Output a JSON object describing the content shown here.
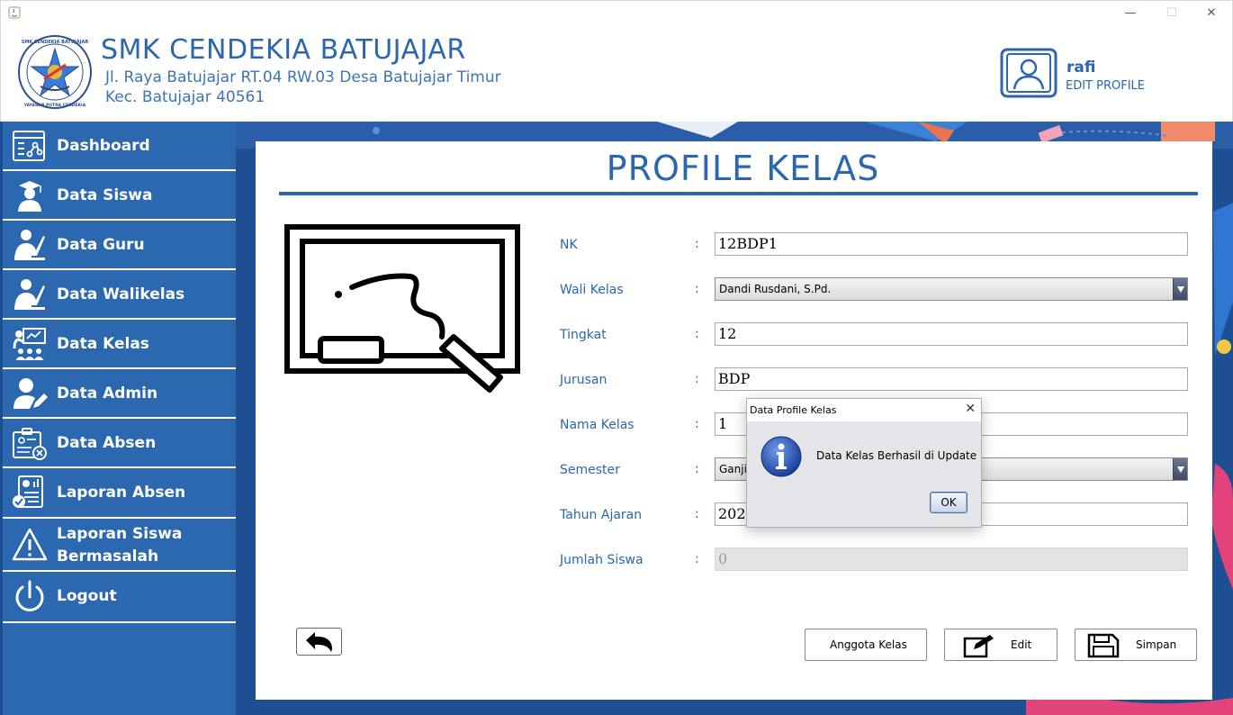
{
  "window": {
    "title": "",
    "min_glyph": "—",
    "max_glyph": "☐",
    "close_glyph": "✕"
  },
  "header": {
    "school_name": "SMK CENDEKIA BATUJAJAR",
    "address_line1": "Jl. Raya Batujajar RT.04 RW.03 Desa Batujajar Timur",
    "address_line2": "Kec. Batujajar 40561",
    "logo_text_top": "SMK CENDEKIA BATUJAJAR",
    "logo_text_bottom": "YAYASAN PUTRA CENDEKIA",
    "user": {
      "name": "rafi",
      "edit_label": "EDIT PROFILE"
    }
  },
  "sidebar": {
    "items": [
      {
        "label": "Dashboard",
        "icon": "dashboard-icon"
      },
      {
        "label": "Data Siswa",
        "icon": "student-icon"
      },
      {
        "label": "Data Guru",
        "icon": "teacher-icon"
      },
      {
        "label": "Data Walikelas",
        "icon": "homeroom-teacher-icon"
      },
      {
        "label": "Data Kelas",
        "icon": "classroom-icon"
      },
      {
        "label": "Data Admin",
        "icon": "admin-icon"
      },
      {
        "label": "Data Absen",
        "icon": "attendance-icon"
      },
      {
        "label": "Laporan Absen",
        "icon": "report-icon"
      },
      {
        "label": "Laporan Siswa Bermasalah",
        "label_line1": "Laporan Siswa",
        "label_line2": "Bermasalah",
        "icon": "warning-icon"
      },
      {
        "label": "Logout",
        "icon": "power-icon"
      }
    ]
  },
  "main": {
    "title": "PROFILE KELAS",
    "fields": [
      {
        "label": "NK",
        "value": "12BDP1",
        "type": "text"
      },
      {
        "label": "Wali Kelas",
        "value": "Dandi Rusdani, S.Pd.",
        "type": "select"
      },
      {
        "label": "Tingkat",
        "value": "12",
        "type": "text"
      },
      {
        "label": "Jurusan",
        "value": "BDP",
        "type": "text"
      },
      {
        "label": "Nama Kelas",
        "value": "1",
        "type": "text"
      },
      {
        "label": "Semester",
        "value": "Ganji",
        "type": "select"
      },
      {
        "label": "Tahun Ajaran",
        "value": "2021",
        "type": "text"
      },
      {
        "label": "Jumlah Siswa",
        "value": "0",
        "type": "text-disabled"
      }
    ],
    "colon": ":",
    "buttons": {
      "anggota": "Anggota Kelas",
      "edit": "Edit",
      "simpan": "Simpan"
    }
  },
  "dialog": {
    "title": "Data Profile Kelas",
    "message": "Data Kelas Berhasil di Update",
    "ok_label": "OK",
    "close_glyph": "✕"
  },
  "colors": {
    "accent_blue": "#2b66ae",
    "sidebar_blue": "#2b68b0",
    "background_navy": "#1f4f93"
  }
}
